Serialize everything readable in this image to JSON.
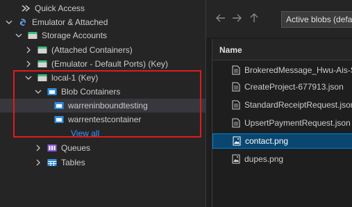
{
  "tree": {
    "quick_access": "Quick Access",
    "emulator_attached": "Emulator & Attached",
    "storage_accounts": "Storage Accounts",
    "attached_containers": "(Attached Containers)",
    "emulator_default": "(Emulator - Default Ports) (Key)",
    "local1": "local-1 (Key)",
    "blob_containers": "Blob Containers",
    "container1": "warreninboundtesting",
    "container2": "warrentestcontainer",
    "view_all": "View all",
    "queues": "Queues",
    "tables": "Tables"
  },
  "toolbar": {
    "active_tab": "Active blobs (default"
  },
  "grid": {
    "column_name": "Name",
    "files": [
      {
        "name": "BrokeredMessage_Hwu-Ais-S"
      },
      {
        "name": "CreateProject-677913.json"
      },
      {
        "name": "StandardReceiptRequest.json"
      },
      {
        "name": "UpsertPaymentRequest.json"
      },
      {
        "name": "contact.png"
      },
      {
        "name": "dupes.png"
      }
    ],
    "selected_index": 4
  },
  "colors": {
    "highlight": "#e01b1b",
    "selection": "#094771",
    "link": "#3794ff"
  }
}
